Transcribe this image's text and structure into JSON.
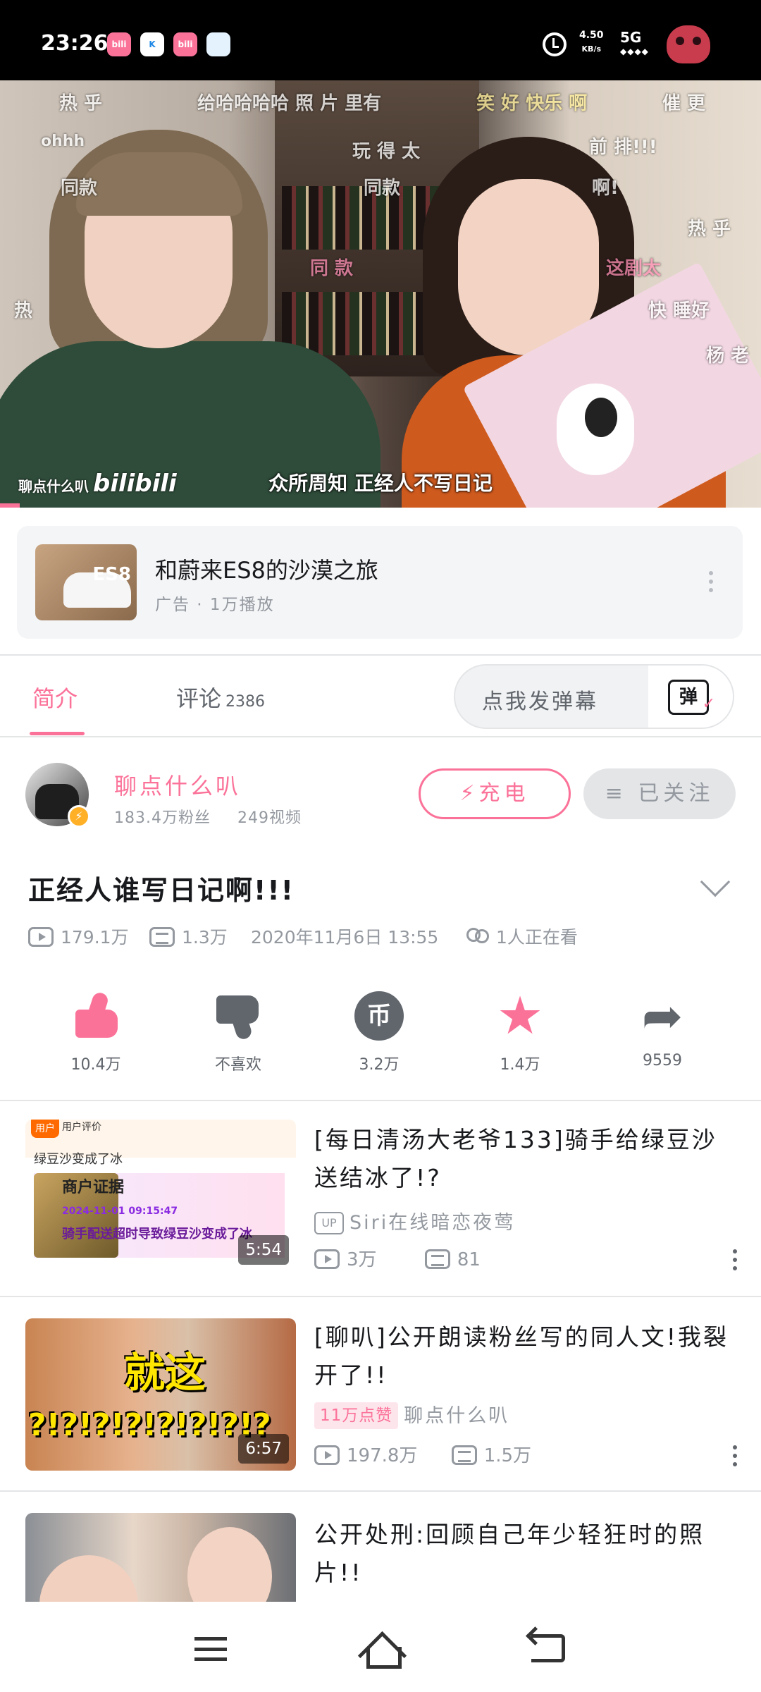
{
  "status_bar": {
    "time": "23:26",
    "app_icons": [
      {
        "name": "bilibili-app-icon",
        "label": "bili",
        "color": "#fb7299"
      },
      {
        "name": "k-app-icon",
        "label": "K",
        "color": "#1e88e5"
      },
      {
        "name": "bilibili-app-icon-2",
        "label": "bili",
        "color": "#fb7299"
      },
      {
        "name": "blue-app-icon",
        "label": "",
        "color": "#1565c0"
      }
    ],
    "net_speed_value": "4.50",
    "net_speed_unit": "KB/s",
    "network": "5G"
  },
  "video": {
    "subtitle": "众所周知 正经人不写日记",
    "watermark_channel": "聊点什么叭",
    "watermark_logo": "bilibili",
    "danmaku": [
      "热 乎",
      "给哈哈哈哈 照 片 里有",
      "笑 好 快乐 啊",
      "催 更",
      "ohhh",
      "玩 得 太",
      "前 排!!!",
      "同款",
      "同款",
      "啊!",
      "热 乎",
      "同 款",
      "这剧太",
      "快 睡好",
      "杨 老",
      "热"
    ]
  },
  "ad": {
    "thumb_label": "ES8",
    "title": "和蔚来ES8的沙漠之旅",
    "subtitle": "广告 · 1万播放"
  },
  "tabs": {
    "intro": "简介",
    "comments": "评论",
    "comment_count": "2386",
    "danmaku_placeholder": "点我发弹幕",
    "danmaku_button": "弹"
  },
  "uploader": {
    "name": "聊点什么叭",
    "fans": "183.4万粉丝",
    "videos": "249视频",
    "charge_label": "充电",
    "follow_label": "已关注"
  },
  "video_info": {
    "title": "正经人谁写日记啊!!!",
    "plays": "179.1万",
    "danmaku_count": "1.3万",
    "publish_time": "2020年11月6日 13:55",
    "watching": "1人正在看"
  },
  "actions": {
    "like": "10.4万",
    "dislike": "不喜欢",
    "coin": "3.2万",
    "coin_symbol": "币",
    "favorite": "1.4万",
    "share": "9559"
  },
  "related": [
    {
      "title": "[每日清汤大老爷133]骑手给绿豆沙送结冰了!?",
      "up_tag": "UP",
      "up": "Siri在线暗恋夜莺",
      "duration": "5:54",
      "plays": "3万",
      "danmaku": "81",
      "thumb_text": {
        "logo": "用户",
        "header": "用户评价",
        "line1": "绿豆沙变成了冰",
        "line2": "商户证据",
        "line3": "2024-11-01 09:15:47",
        "line4": "骑手配送超时导致绿豆沙变成了冰"
      }
    },
    {
      "title": "[聊叭]公开朗读粉丝写的同人文!我裂开了!!",
      "hot_tag": "11万点赞",
      "up": "聊点什么叭",
      "duration": "6:57",
      "plays": "197.8万",
      "danmaku": "1.5万",
      "thumb_text": {
        "big": "就这",
        "row": "?!?!?!?!?!?!?!?"
      }
    },
    {
      "title": "公开处刑:回顾自己年少轻狂时的照片!!"
    }
  ]
}
